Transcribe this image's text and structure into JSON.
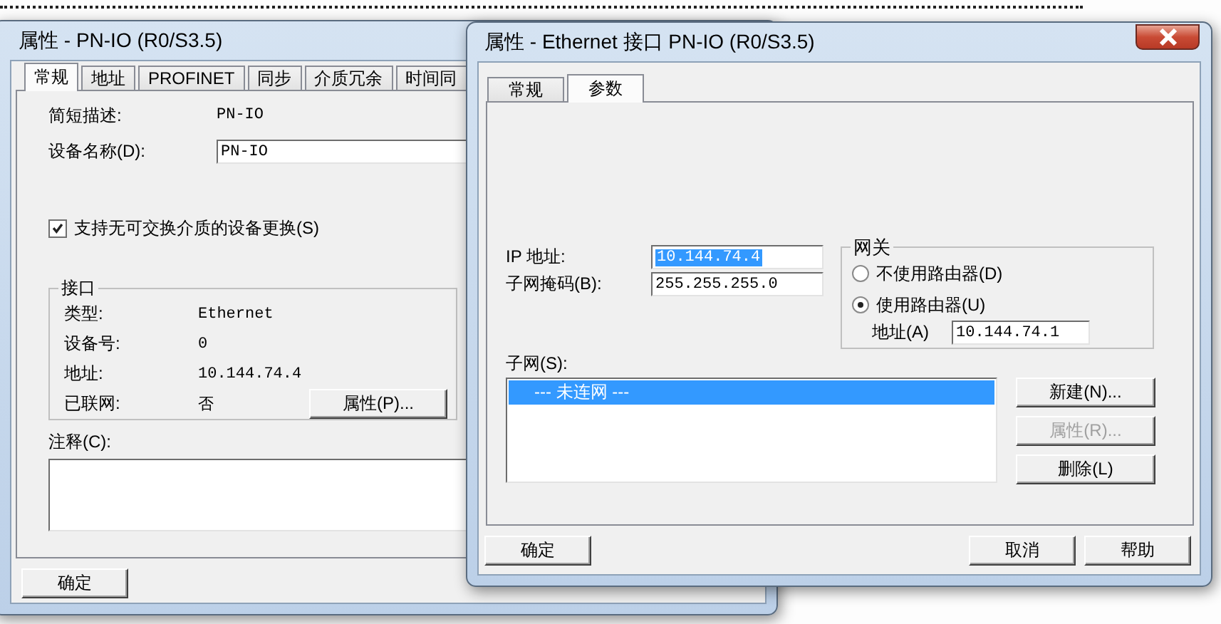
{
  "device_dialog": {
    "title": "属性 - PN-IO (R0/S3.5)",
    "tabs": [
      {
        "label": "常规",
        "selected": true
      },
      {
        "label": "地址",
        "selected": false
      },
      {
        "label": "PROFINET",
        "selected": false
      },
      {
        "label": "同步",
        "selected": false
      },
      {
        "label": "介质冗余",
        "selected": false
      },
      {
        "label": "时间同",
        "selected": false
      }
    ],
    "short_description": {
      "label": "简短描述:",
      "value": "PN-IO"
    },
    "device_name": {
      "label": "设备名称(D):",
      "value": "PN-IO"
    },
    "replacement_option": {
      "label": "支持无可交换介质的设备更换(S)",
      "checked": true
    },
    "interface": {
      "title": "接口",
      "rows": [
        {
          "label": "类型:",
          "value": "Ethernet"
        },
        {
          "label": "设备号:",
          "value": "0"
        },
        {
          "label": "地址:",
          "value": "10.144.74.4"
        },
        {
          "label": "已联网:",
          "value": "否"
        }
      ],
      "button": "属性(P)..."
    },
    "comment": {
      "label": "注释(C):"
    },
    "ok_button": "确定"
  },
  "interface_dialog": {
    "title": "属性 - Ethernet 接口  PN-IO (R0/S3.5)",
    "tabs": [
      {
        "label": "常规",
        "selected": false
      },
      {
        "label": "参数",
        "selected": true
      }
    ],
    "ip_address": {
      "label": "IP 地址:",
      "value": "10.144.74.4",
      "text_selected": true
    },
    "subnet_mask": {
      "label": "子网掩码(B):",
      "value": "255.255.255.0",
      "text_selected": false
    },
    "gateway": {
      "title": "网关",
      "options": [
        {
          "label": "不使用路由器(D)",
          "selected": false
        },
        {
          "label": "使用路由器(U)",
          "selected": true
        }
      ],
      "address": {
        "label": "地址(A)",
        "value": "10.144.74.1"
      }
    },
    "subnet": {
      "label": "子网(S):",
      "items": [
        {
          "label": "--- 未连网 ---",
          "selected": true
        }
      ],
      "buttons": [
        {
          "label": "新建(N)...",
          "disabled": false
        },
        {
          "label": "属性(R)...",
          "disabled": true
        },
        {
          "label": "删除(L)",
          "disabled": false
        }
      ]
    },
    "left_buttons": [
      "确定"
    ],
    "right_buttons": [
      "取消",
      "帮助"
    ]
  }
}
